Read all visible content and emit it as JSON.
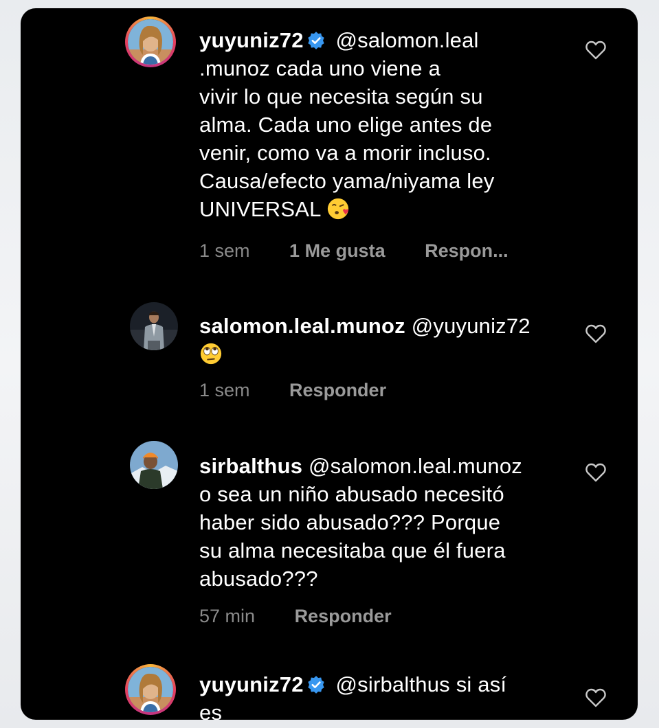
{
  "comments": [
    {
      "username": "yuyuniz72",
      "verified": true,
      "mention": "@salomon.leal",
      "lines": [
        ".munoz cada uno viene a",
        "vivir lo que necesita según su",
        "alma. Cada uno elige antes de",
        "venir, como va a morir incluso.",
        "Causa/efecto yama/niyama ley",
        "UNIVERSAL"
      ],
      "emoji": "face-blowing-kiss-emoji",
      "time": "1 sem",
      "likes": "1 Me gusta",
      "reply": "Respon..."
    },
    {
      "username": "salomon.leal.munoz",
      "verified": false,
      "mention": "@yuyuniz72",
      "emoji": "face-rolling-eyes-emoji",
      "time": "1 sem",
      "reply": "Responder"
    },
    {
      "username": "sirbalthus",
      "verified": false,
      "mention": "@salomon.leal.munoz",
      "lines": [
        "o sea un niño abusado necesitó",
        "haber sido abusado??? Porque",
        "su alma necesitaba que él fuera",
        "abusado???"
      ],
      "time": "57 min",
      "reply": "Responder"
    },
    {
      "username": "yuyuniz72",
      "verified": true,
      "mention": "@sirbalthus",
      "text_after": "si así",
      "lines": [
        "es"
      ]
    }
  ],
  "colors": {
    "background": "#000000",
    "text": "#ffffff",
    "meta": "#8a8a8a",
    "verified": "#3897f0"
  },
  "icons": {
    "like": "heart-outline-icon",
    "verified": "verified-badge-icon"
  }
}
